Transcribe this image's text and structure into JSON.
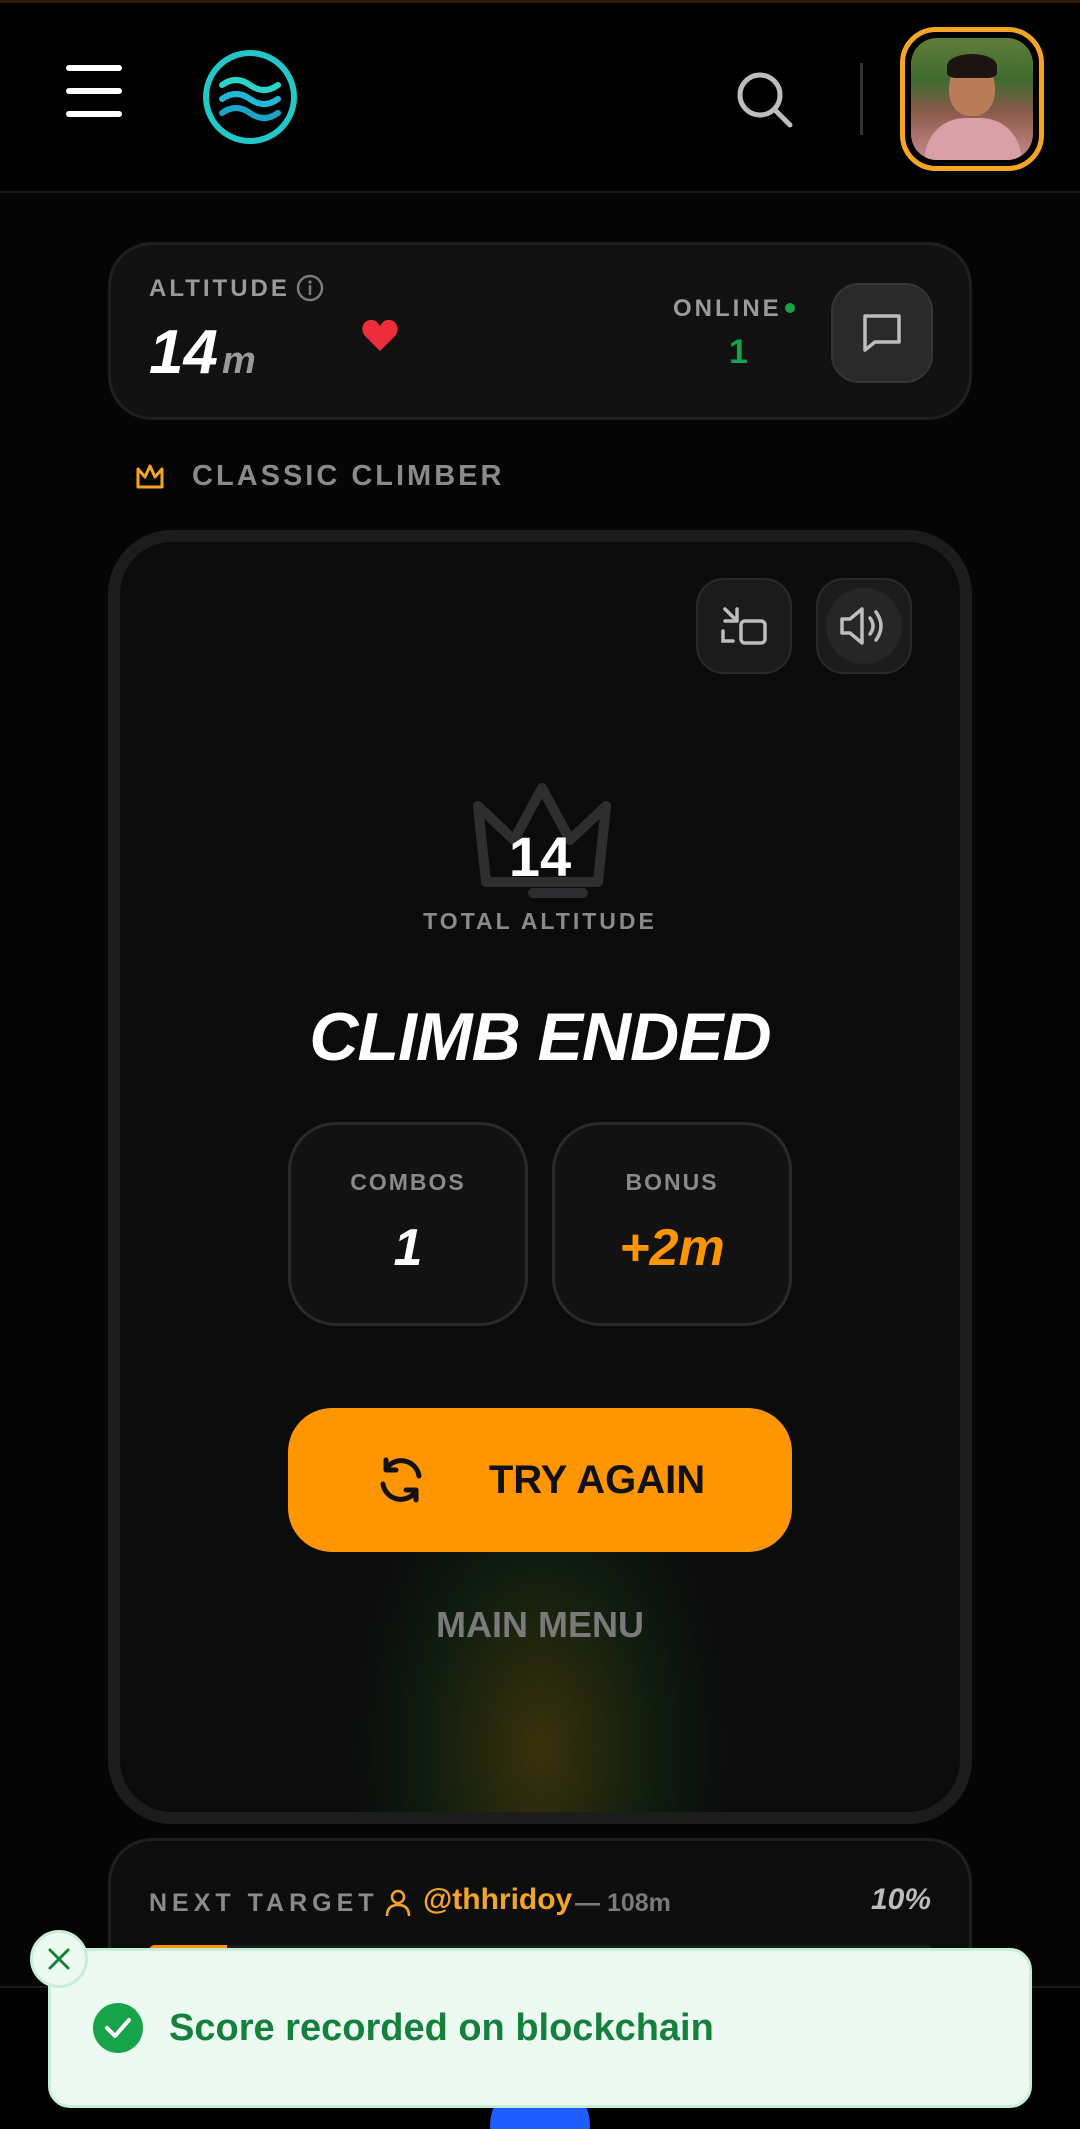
{
  "header": {
    "menu_icon": "hamburger-menu-icon",
    "logo_icon": "waves-logo-icon",
    "search_icon": "search-icon",
    "avatar_alt": "user-avatar"
  },
  "stats": {
    "altitude_label": "ALTITUDE",
    "altitude_value": "14",
    "altitude_unit": "m",
    "online_label": "ONLINE",
    "online_value": "1",
    "heart_color": "#ef2d3a",
    "online_color": "#16a34a"
  },
  "mode": {
    "label": "CLASSIC CLIMBER",
    "icon": "crown-outline-icon"
  },
  "game": {
    "total_value": "14",
    "total_label": "TOTAL ALTITUDE",
    "headline": "CLIMB ENDED",
    "combos_label": "COMBOS",
    "combos_value": "1",
    "bonus_label": "BONUS",
    "bonus_value": "+2m",
    "try_again_label": "TRY AGAIN",
    "main_menu_label": "MAIN MENU",
    "accent_color": "#ff9500"
  },
  "next_target": {
    "label": "NEXT TARGET",
    "user": "@thhridoy",
    "distance": "— 108m",
    "percent_label": "10%",
    "progress_fraction": 0.1
  },
  "toast": {
    "message": "Score recorded on blockchain",
    "color": "#15803d"
  }
}
